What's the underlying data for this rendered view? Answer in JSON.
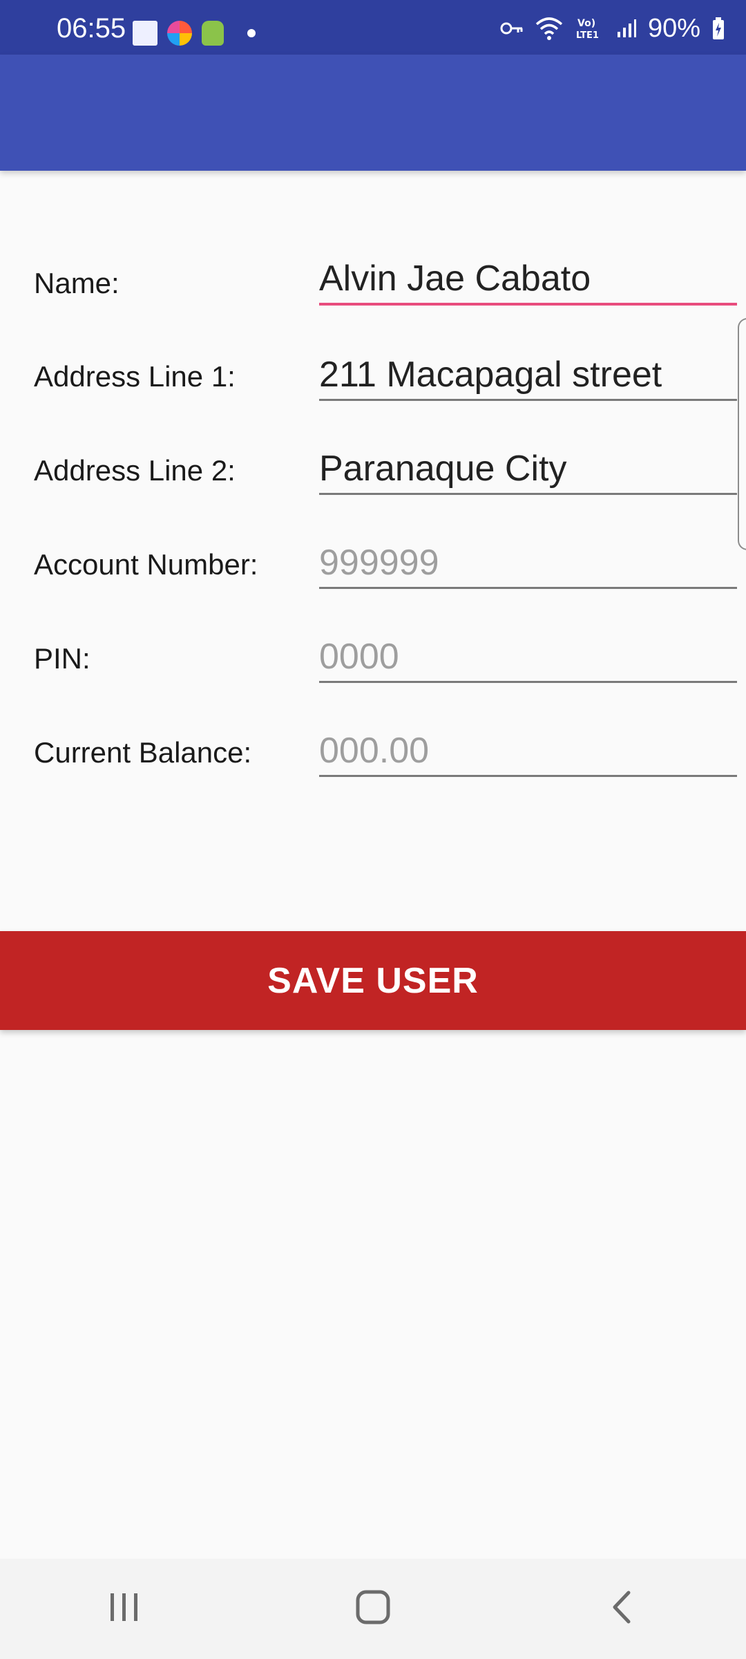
{
  "status_bar": {
    "time": "06:55",
    "battery": "90%",
    "icons": [
      "key-icon",
      "wifi-icon",
      "volte-icon",
      "signal-icon",
      "battery-icon"
    ]
  },
  "form": {
    "name": {
      "label": "Name:",
      "value": "Alvin Jae Cabato",
      "placeholder": ""
    },
    "address1": {
      "label": "Address Line 1:",
      "value": "211 Macapagal street",
      "placeholder": ""
    },
    "address2": {
      "label": "Address Line 2:",
      "value": "Paranaque City",
      "placeholder": ""
    },
    "account_number": {
      "label": "Account Number:",
      "value": "",
      "placeholder": "999999"
    },
    "pin": {
      "label": "PIN:",
      "value": "",
      "placeholder": "0000"
    },
    "current_balance": {
      "label": "Current Balance:",
      "value": "",
      "placeholder": "000.00"
    }
  },
  "save_button": {
    "label": "SAVE USER"
  },
  "colors": {
    "status_bar": "#2f3f9e",
    "app_bar": "#3f51b5",
    "accent_underline": "#e84c7d",
    "save_button": "#c12424"
  },
  "nav_bar": {
    "buttons": [
      "recent-apps-icon",
      "home-icon",
      "back-icon"
    ]
  }
}
